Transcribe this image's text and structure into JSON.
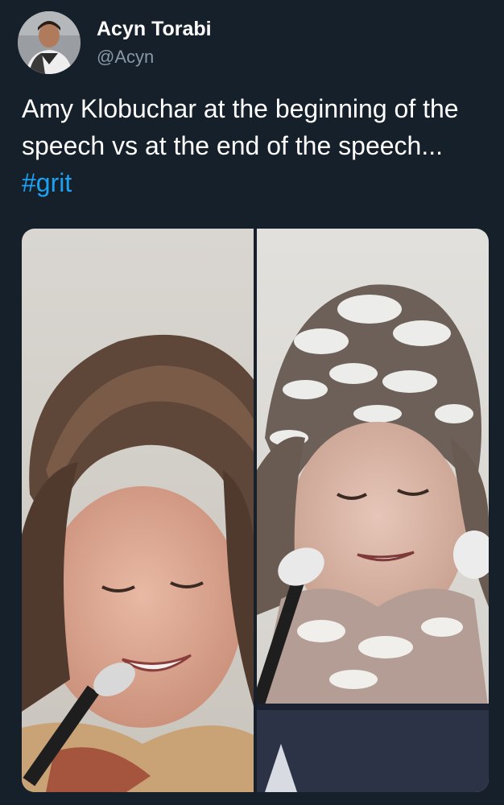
{
  "tweet": {
    "author": {
      "display_name": "Acyn Torabi",
      "handle": "@Acyn"
    },
    "text_before_hashtag": "Amy Klobuchar at the beginning of the speech vs at the end of the speech... ",
    "hashtag": "#grit",
    "colors": {
      "background": "#15202b",
      "text": "#ffffff",
      "secondary_text": "#8899a6",
      "link": "#1da1f2"
    }
  }
}
